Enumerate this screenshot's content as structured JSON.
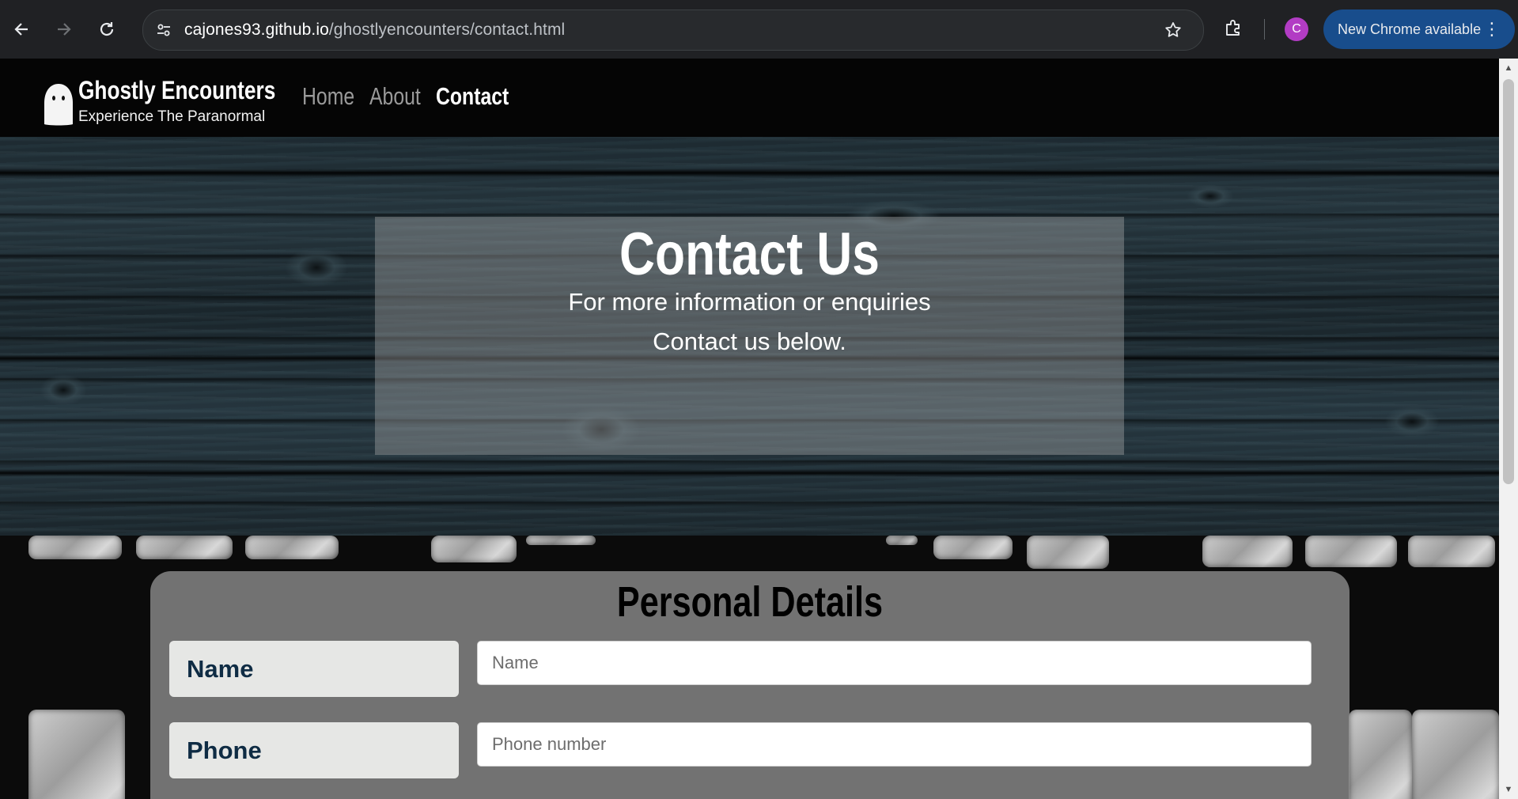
{
  "browser": {
    "url_host": "cajones93.github.io",
    "url_path": "/ghostlyencounters/contact.html",
    "profile_initial": "C",
    "update_label": "New Chrome available",
    "icons": [
      "back-arrow-icon",
      "forward-arrow-icon",
      "reload-icon",
      "site-info-icon",
      "star-icon",
      "extensions-icon",
      "kebab-menu-icon"
    ]
  },
  "site": {
    "brand_title": "Ghostly Encounters",
    "brand_tagline": "Experience The Paranormal",
    "logo_icon": "ghost-icon",
    "nav": [
      {
        "label": "Home"
      },
      {
        "label": "About"
      },
      {
        "label": "Contact"
      }
    ]
  },
  "hero": {
    "title": "Contact Us",
    "line1": "For more information or enquiries",
    "line2": "Contact us below."
  },
  "form": {
    "heading": "Personal Details",
    "fields": [
      {
        "label": "Name",
        "placeholder": "Name"
      },
      {
        "label": "Phone",
        "placeholder": "Phone number"
      }
    ]
  },
  "colors": {
    "chrome_bg": "#202124",
    "update_btn": "#184d8c",
    "profile": "#b23cc4",
    "label_text": "#0f2c44",
    "label_bg": "#e6e7e5"
  }
}
